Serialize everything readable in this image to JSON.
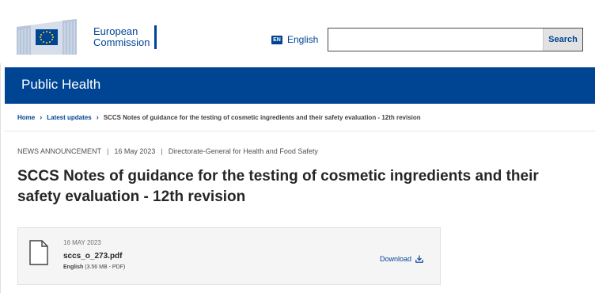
{
  "header": {
    "logo_line1": "European",
    "logo_line2": "Commission",
    "language": {
      "code": "EN",
      "label": "English"
    },
    "search": {
      "value": "",
      "button_label": "Search"
    }
  },
  "site": {
    "title": "Public Health"
  },
  "breadcrumb": {
    "items": [
      "Home",
      "Latest updates"
    ],
    "current": "SCCS Notes of guidance for the testing of cosmetic ingredients and their safety evaluation - 12th revision"
  },
  "meta": {
    "type": "NEWS ANNOUNCEMENT",
    "date": "16 May 2023",
    "department": "Directorate-General for Health and Food Safety"
  },
  "page": {
    "title": "SCCS Notes of guidance for the testing of cosmetic ingredients and their safety evaluation - 12th revision"
  },
  "file": {
    "date": "16 MAY 2023",
    "name": "sccs_o_273.pdf",
    "language": "English",
    "details": "(3.56 MB - PDF)",
    "download_label": "Download"
  },
  "colors": {
    "brand_blue": "#004494",
    "title_text": "#262626"
  }
}
